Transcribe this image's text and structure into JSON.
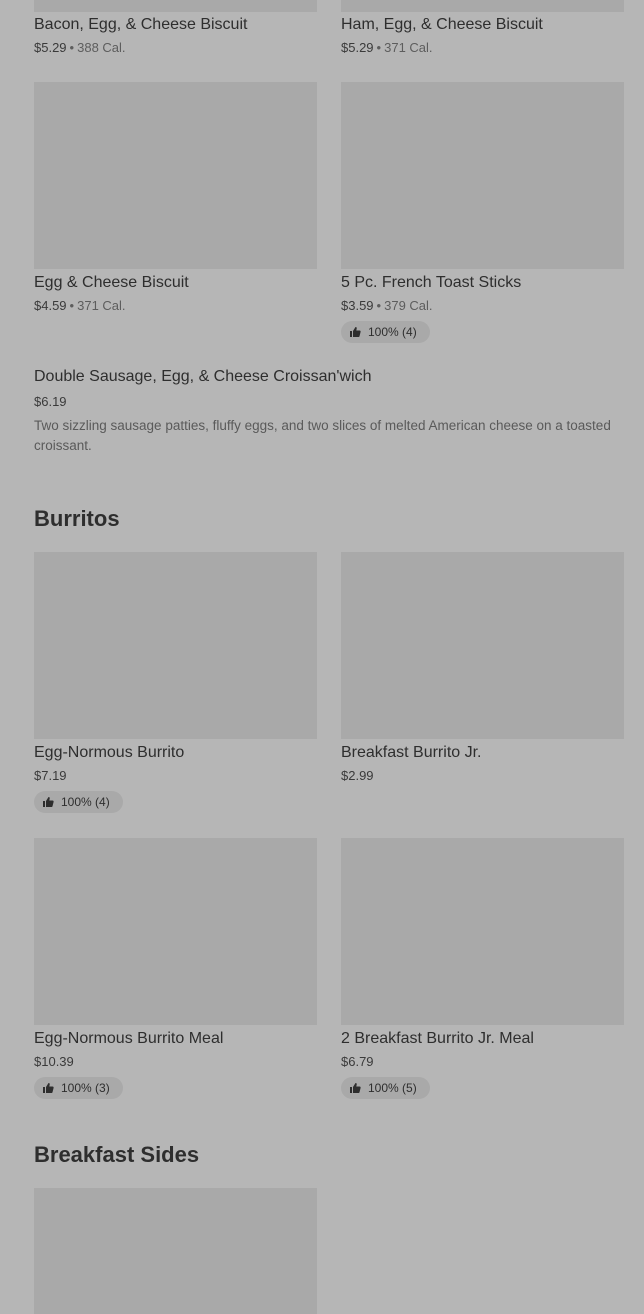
{
  "top_row": [
    {
      "name": "Bacon, Egg, & Cheese Biscuit",
      "price": "$5.29",
      "calories": "388 Cal."
    },
    {
      "name": "Ham, Egg, & Cheese Biscuit",
      "price": "$5.29",
      "calories": "371 Cal."
    }
  ],
  "second_row": [
    {
      "name": "Egg & Cheese Biscuit",
      "price": "$4.59",
      "calories": "371 Cal."
    },
    {
      "name": "5 Pc. French Toast Sticks",
      "price": "$3.59",
      "calories": "379 Cal.",
      "rating": "100% (4)"
    }
  ],
  "croissant": {
    "name": "Double Sausage, Egg, & Cheese Croissan'wich",
    "price": "$6.19",
    "description": "Two sizzling sausage patties, fluffy eggs, and two slices of melted American cheese on a toasted croissant."
  },
  "burritos": {
    "title": "Burritos",
    "items": [
      {
        "name": "Egg-Normous Burrito",
        "price": "$7.19",
        "rating": "100% (4)"
      },
      {
        "name": "Breakfast Burrito Jr.",
        "price": "$2.99"
      },
      {
        "name": "Egg-Normous Burrito Meal",
        "price": "$10.39",
        "rating": "100% (3)"
      },
      {
        "name": "2 Breakfast Burrito Jr. Meal",
        "price": "$6.79",
        "rating": "100% (5)"
      }
    ]
  },
  "breakfast_sides": {
    "title": "Breakfast Sides"
  },
  "icons": {
    "rating": "thumbs-up-icon"
  },
  "colors": {
    "background": "#b6b6b6",
    "image_placeholder": "#a9a9a9",
    "text": "#2e2e2e"
  }
}
